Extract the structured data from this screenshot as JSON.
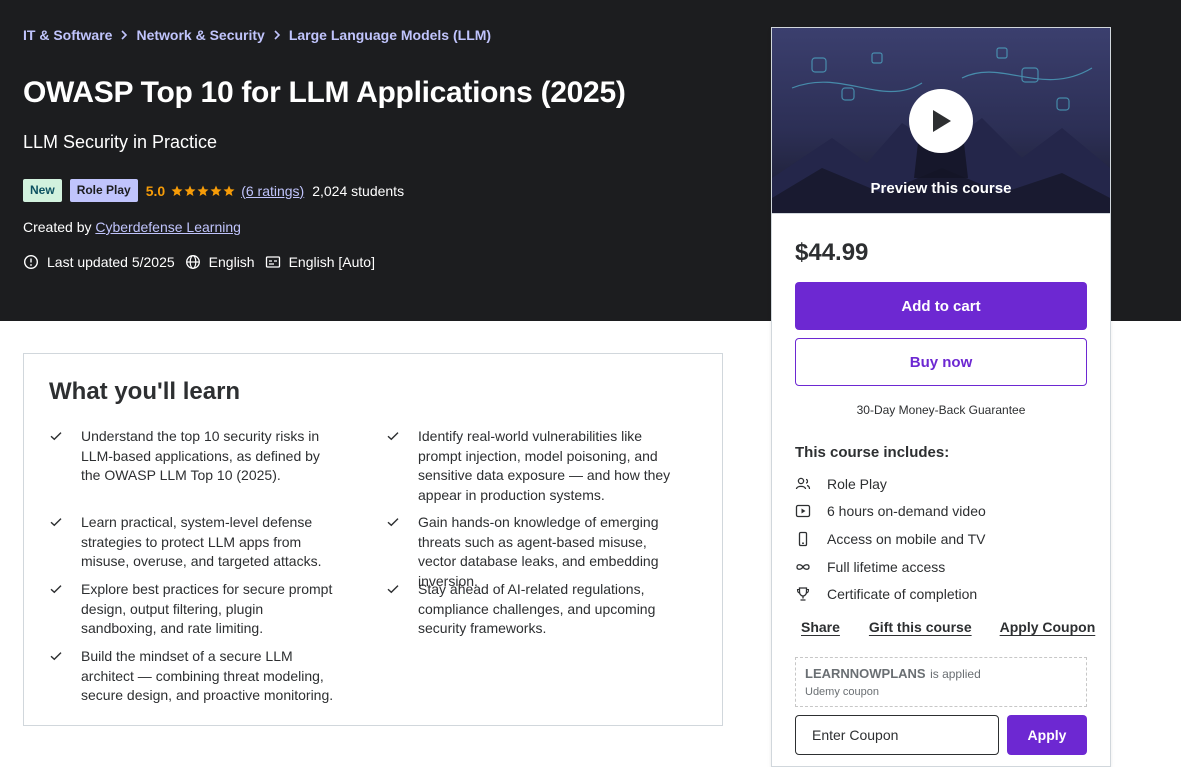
{
  "breadcrumb": [
    "IT & Software",
    "Network & Security",
    "Large Language Models (LLM)"
  ],
  "course": {
    "title": "OWASP Top 10 for LLM Applications (2025)",
    "subtitle": "LLM Security in Practice",
    "badge_new": "New",
    "badge_role": "Role Play",
    "rating": "5.0",
    "stars": 5,
    "ratings_count": "(6 ratings)",
    "students": "2,024 students",
    "created_prefix": "Created by",
    "author": "Cyberdefense Learning",
    "last_updated": "Last updated 5/2025",
    "language": "English",
    "captions": "English [Auto]"
  },
  "learn": {
    "title": "What you'll learn",
    "items": [
      "Understand the top 10 security risks in LLM-based applications, as defined by the OWASP LLM Top 10 (2025).",
      "Identify real-world vulnerabilities like prompt injection, model poisoning, and sensitive data exposure — and how they appear in production systems.",
      "Learn practical, system-level defense strategies to protect LLM apps from misuse, overuse, and targeted attacks.",
      "Gain hands-on knowledge of emerging threats such as agent-based misuse, vector database leaks, and embedding inversion.",
      "Explore best practices for secure prompt design, output filtering, plugin sandboxing, and rate limiting.",
      "Stay ahead of AI-related regulations, compliance challenges, and upcoming security frameworks.",
      "Build the mindset of a secure LLM architect — combining threat modeling, secure design, and proactive monitoring."
    ]
  },
  "sidebar": {
    "preview_label": "Preview this course",
    "price": "$44.99",
    "add_to_cart": "Add to cart",
    "buy_now": "Buy now",
    "guarantee": "30-Day Money-Back Guarantee",
    "includes_title": "This course includes:",
    "includes": [
      {
        "icon": "role-play-icon",
        "label": "Role Play"
      },
      {
        "icon": "video-icon",
        "label": "6 hours on-demand video"
      },
      {
        "icon": "mobile-icon",
        "label": "Access on mobile and TV"
      },
      {
        "icon": "infinity-icon",
        "label": "Full lifetime access"
      },
      {
        "icon": "trophy-icon",
        "label": "Certificate of completion"
      }
    ],
    "share": "Share",
    "gift": "Gift this course",
    "apply_coupon": "Apply Coupon",
    "coupon_code": "LEARNNOWPLANS",
    "coupon_applied": "is applied",
    "coupon_sub": "Udemy coupon",
    "coupon_placeholder": "Enter Coupon",
    "apply": "Apply"
  },
  "colors": {
    "hero_bg": "#1c1d1f",
    "accent": "#6d28d2",
    "link_light": "#c0c4fc",
    "star": "#f69c08"
  }
}
